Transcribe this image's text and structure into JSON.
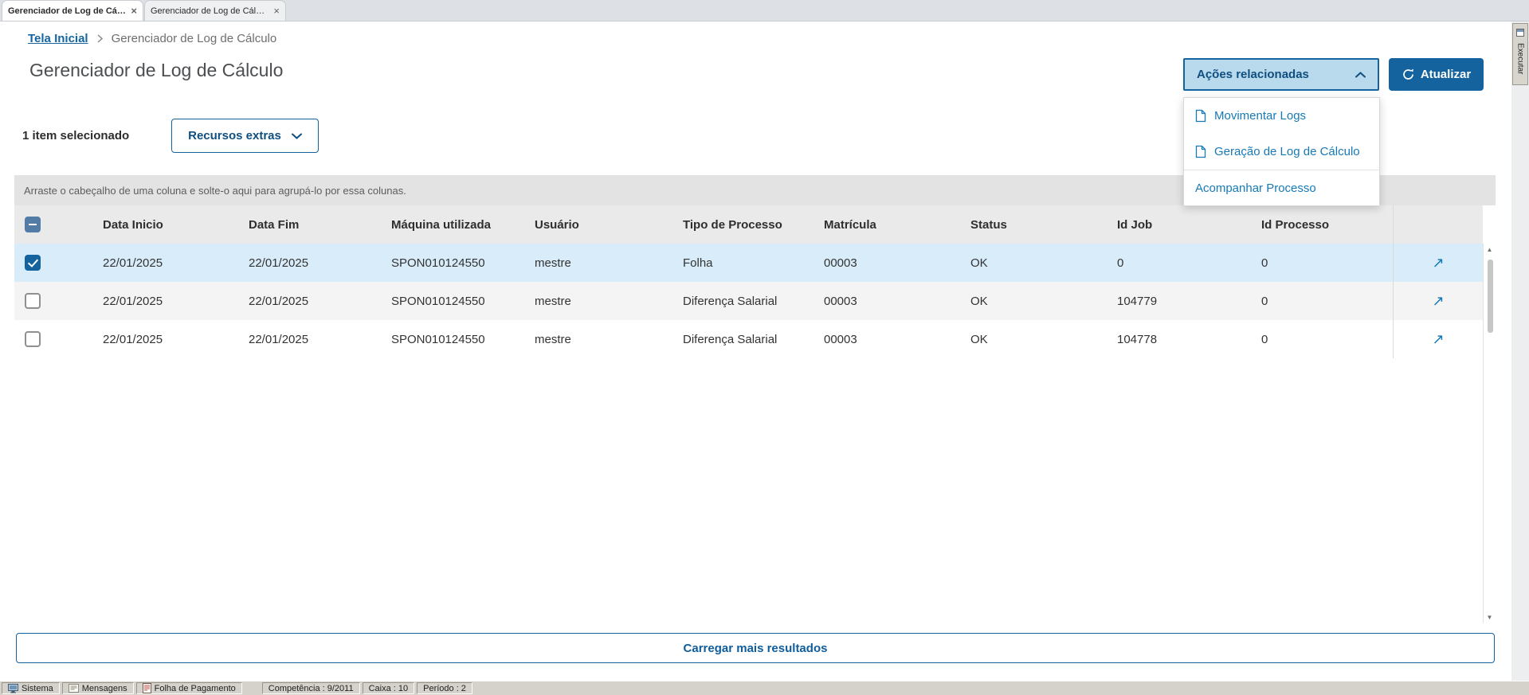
{
  "window_tabs": [
    {
      "label": "Gerenciador de Log de Cálculo",
      "active": true
    },
    {
      "label": "Gerenciador de Log de Cálculo",
      "active": false
    }
  ],
  "side_tab": {
    "label": "Executar"
  },
  "breadcrumb": {
    "home": "Tela Inicial",
    "current": "Gerenciador de Log de Cálculo"
  },
  "page": {
    "title": "Gerenciador de Log de Cálculo"
  },
  "toolbar": {
    "selection_text": "1 item selecionado",
    "recursos_extras_label": "Recursos extras",
    "acoes_relacionadas_label": "Ações relacionadas",
    "atualizar_label": "Atualizar"
  },
  "actions_menu": {
    "items": [
      {
        "label": "Movimentar Logs",
        "icon": "document-icon",
        "divider_before": false
      },
      {
        "label": "Geração de Log de Cálculo",
        "icon": "document-icon",
        "divider_before": false
      },
      {
        "label": "Acompanhar Processo",
        "icon": null,
        "divider_before": true
      }
    ]
  },
  "grid": {
    "group_hint": "Arraste o cabeçalho de uma coluna e solte-o aqui para agrupá-lo por essa colunas.",
    "columns": [
      "Data Inicio",
      "Data Fim",
      "Máquina utilizada",
      "Usuário",
      "Tipo de Processo",
      "Matrícula",
      "Status",
      "Id Job",
      "Id Processo"
    ],
    "rows": [
      {
        "selected": true,
        "cells": [
          "22/01/2025",
          "22/01/2025",
          "SPON010124550",
          "mestre",
          "Folha",
          "00003",
          "OK",
          "0",
          "0"
        ]
      },
      {
        "selected": false,
        "cells": [
          "22/01/2025",
          "22/01/2025",
          "SPON010124550",
          "mestre",
          "Diferença Salarial",
          "00003",
          "OK",
          "104779",
          "0"
        ]
      },
      {
        "selected": false,
        "cells": [
          "22/01/2025",
          "22/01/2025",
          "SPON010124550",
          "mestre",
          "Diferença Salarial",
          "00003",
          "OK",
          "104778",
          "0"
        ]
      }
    ],
    "load_more_label": "Carregar mais resultados"
  },
  "status_bar": {
    "items": [
      {
        "label": "Sistema",
        "icon": "system-icon"
      },
      {
        "label": "Mensagens",
        "icon": "messages-icon"
      },
      {
        "label": "Folha de Pagamento",
        "icon": "payroll-icon"
      },
      {
        "label": "Competência : 9/2011",
        "icon": null
      },
      {
        "label": "Caixa : 10",
        "icon": null
      },
      {
        "label": "Período : 2",
        "icon": null
      }
    ]
  },
  "colors": {
    "accent": "#14639e",
    "link": "#1779b6",
    "button-light": "#b9d9ec",
    "selected-row": "#d8ecfa"
  }
}
